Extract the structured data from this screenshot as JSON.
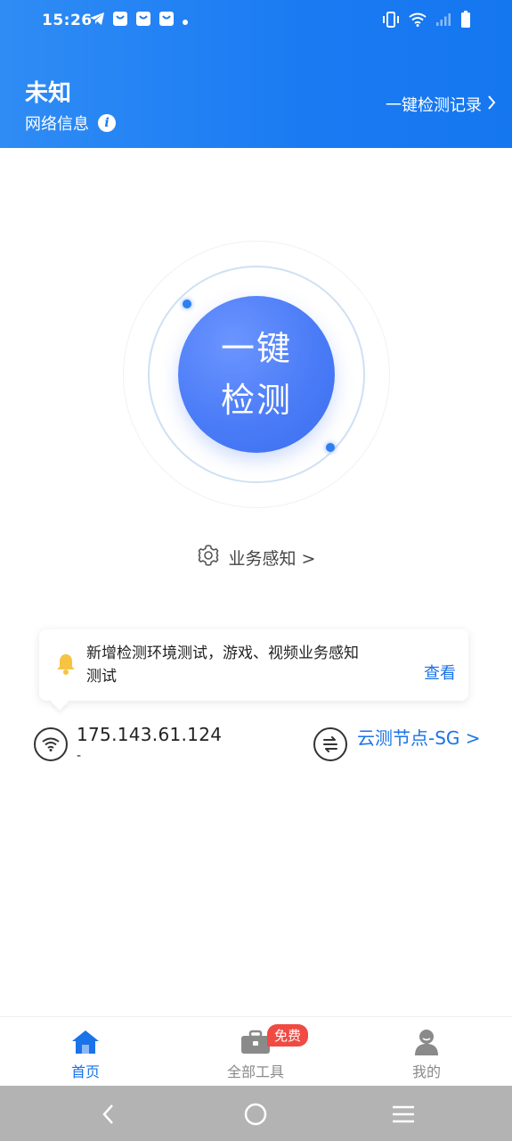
{
  "status_bar": {
    "time": "15:26",
    "notification_icons": [
      "telegram-icon",
      "shopping-bag-icon",
      "shopping-bag-icon",
      "shopping-bag-icon",
      "dot-icon"
    ],
    "right_icons": [
      "vibrate-icon",
      "wifi-icon",
      "signal-icon",
      "battery-icon"
    ]
  },
  "header": {
    "network_type": "未知",
    "network_info_label": "网络信息",
    "info_icon_glyph": "i",
    "record_link": "一键检测记录",
    "background_color": "#1a7af2"
  },
  "detect": {
    "line1": "一键",
    "line2": "检测"
  },
  "business": {
    "label": "业务感知 >"
  },
  "notice": {
    "text": "新增检测环境测试，游戏、视频业务感知测试",
    "view_label": "查看"
  },
  "connection": {
    "ip": "175.143.61.124",
    "ip_sub": "-",
    "node_label": "云测节点-SG >"
  },
  "tabs": [
    {
      "label": "首页",
      "icon": "home-icon",
      "active": true
    },
    {
      "label": "全部工具",
      "icon": "toolbox-icon",
      "active": false,
      "badge": "免费"
    },
    {
      "label": "我的",
      "icon": "user-icon",
      "active": false
    }
  ],
  "nav": {
    "buttons": [
      "back-icon",
      "home-circle-icon",
      "menu-icon"
    ]
  },
  "colors": {
    "accent": "#1a73e8",
    "badge": "#f04a43"
  }
}
